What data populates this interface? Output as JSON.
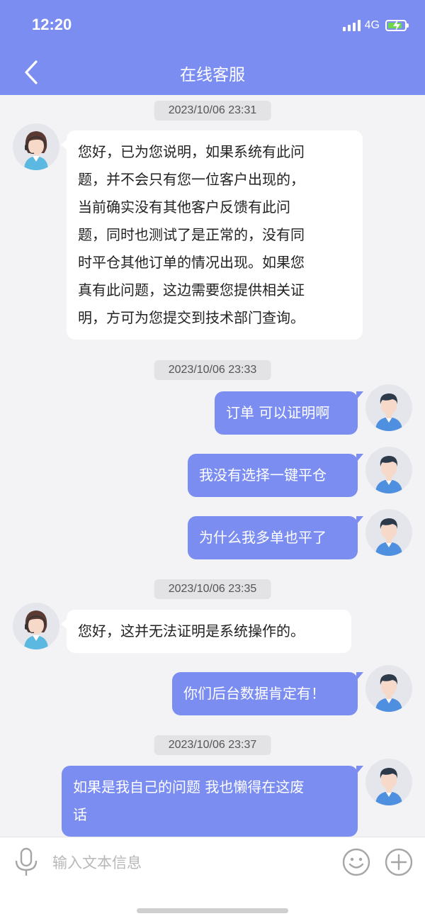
{
  "status_bar": {
    "time": "12:20",
    "network": "4G",
    "battery_level": 0.85,
    "battery_color": "#6ed84c"
  },
  "header": {
    "title": "在线客服",
    "back_icon": "chevron-left-icon",
    "background": "#7b8df1"
  },
  "timestamps": [
    "2023/10/06 23:31",
    "2023/10/06 23:33",
    "2023/10/06 23:35",
    "2023/10/06 23:37"
  ],
  "messages": [
    {
      "sender": "agent",
      "lines": [
        "您好，已为您说明，如果系统有此问",
        "题，并不会只有您一位客户出现的，",
        "当前确实没有其他客户反馈有此问",
        "题，同时也测试了是正常的，没有同",
        "时平仓其他订单的情况出现。如果您",
        "真有此问题，这边需要您提供相关证",
        "明，方可为您提交到技术部门查询。"
      ]
    },
    {
      "sender": "user",
      "lines": [
        "订单 可以证明啊"
      ]
    },
    {
      "sender": "user",
      "lines": [
        "我没有选择一键平仓"
      ]
    },
    {
      "sender": "user",
      "lines": [
        "为什么我多单也平了"
      ]
    },
    {
      "sender": "agent",
      "lines": [
        "您好，这并无法证明是系统操作的。"
      ]
    },
    {
      "sender": "user",
      "lines": [
        "你们后台数据肯定有！"
      ]
    },
    {
      "sender": "user",
      "lines": [
        "如果是我自己的问题 我也懒得在这废",
        "话"
      ]
    }
  ],
  "input_bar": {
    "placeholder": "输入文本信息",
    "mic_icon": "microphone-icon",
    "emoji_icon": "emoji-icon",
    "plus_icon": "plus-circle-icon"
  },
  "colors": {
    "accent": "#7b8df1",
    "chat_background": "#f3f3f5",
    "agent_bubble": "#ffffff",
    "user_bubble": "#7b8df1"
  }
}
